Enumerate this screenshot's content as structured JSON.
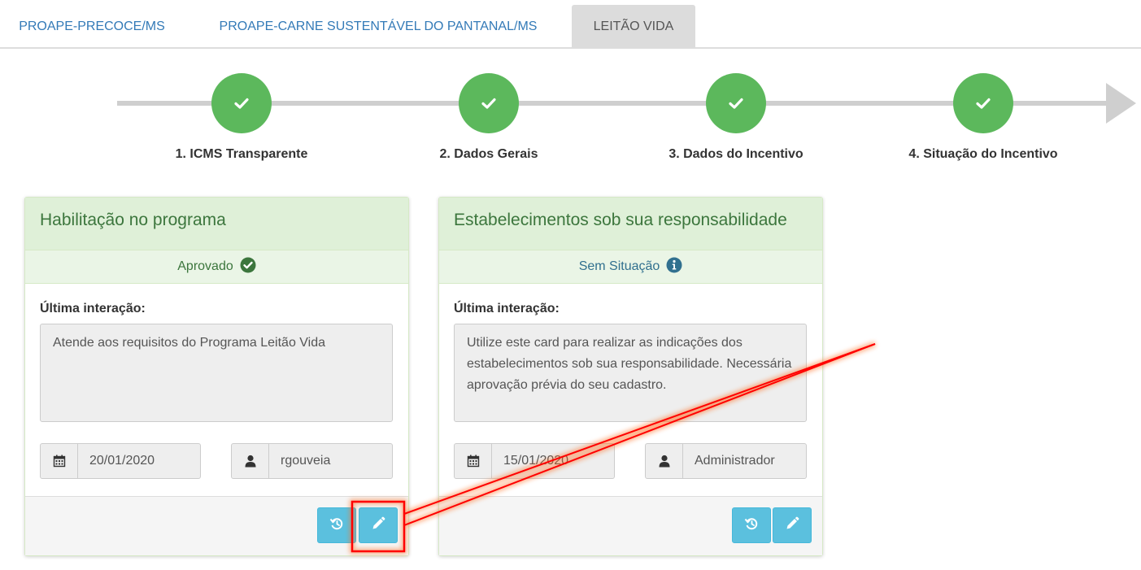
{
  "tabs": [
    {
      "label": "PROAPE-PRECOCE/MS"
    },
    {
      "label": "PROAPE-CARNE SUSTENTÁVEL DO PANTANAL/MS"
    },
    {
      "label": "LEITÃO VIDA"
    }
  ],
  "stepper": {
    "steps": [
      {
        "label": "1. ICMS Transparente",
        "state": "done"
      },
      {
        "label": "2. Dados Gerais",
        "state": "done"
      },
      {
        "label": "3. Dados do Incentivo",
        "state": "done"
      },
      {
        "label": "4. Situação do Incentivo",
        "state": "done"
      }
    ]
  },
  "cards": [
    {
      "title": "Habilitação no programa",
      "status": "Aprovado",
      "status_icon": "check-circle-icon",
      "last_label": "Última interação:",
      "message": "Atende aos requisitos do Programa Leitão Vida",
      "date": "20/01/2020",
      "user": "rgouveia"
    },
    {
      "title": "Estabelecimentos sob sua responsabilidade",
      "status": "Sem Situação",
      "status_icon": "info-circle-icon",
      "last_label": "Última interação:",
      "message": "Utilize este card para realizar as indicações dos estabelecimentos sob sua responsabilidade. Necessária aprovação prévia do seu cadastro.",
      "date": "15/01/2020",
      "user": "Administrador"
    }
  ],
  "colors": {
    "success": "#5cb85c",
    "info_button": "#5bc0de",
    "tab_link": "#337ab7",
    "annotation": "#ff0000"
  }
}
